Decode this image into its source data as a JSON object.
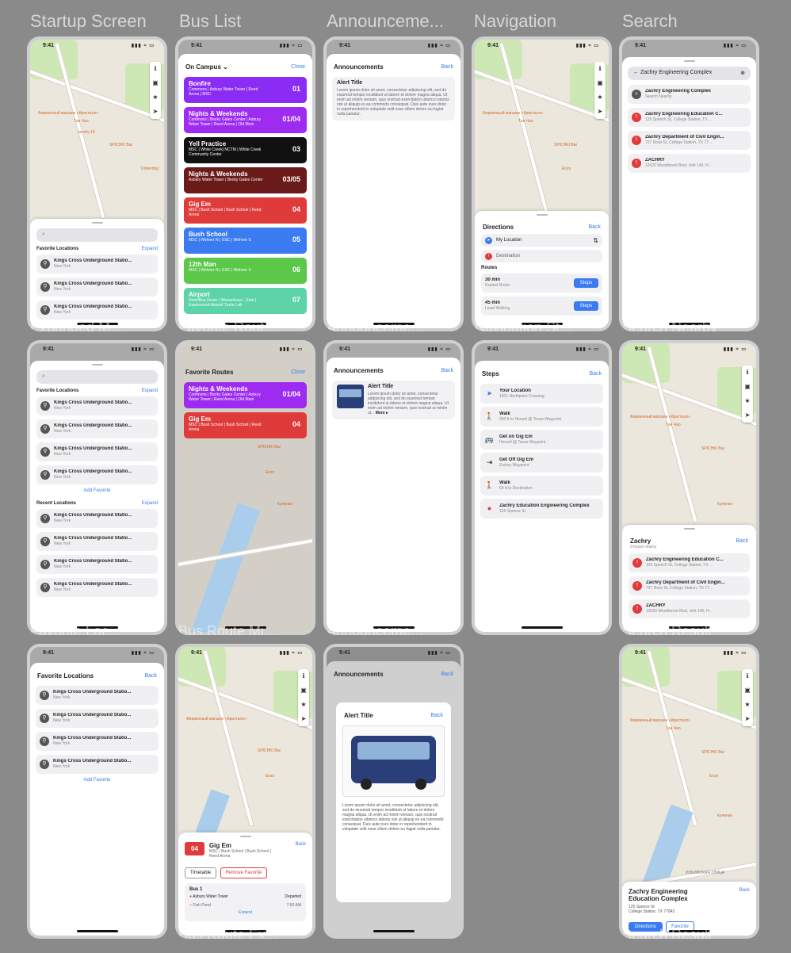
{
  "columns": [
    "Startup Screen",
    "Bus List",
    "Announceme...",
    "Navigation",
    "Search"
  ],
  "status_time": "9:41",
  "status_icons": "▮▮▮ ≈ ▭",
  "map_pois": {
    "poi1": "Фирменный магазин «Кристалл»",
    "poi2": "Тан Чао",
    "poi3": "vershy 19",
    "poi4": "SPICHKI Bar",
    "poi5": "Underdog",
    "poi6": "Enzo",
    "poi7": "Кулинан",
    "street": "ИЛЬИНСКАЯ УЛИЦА"
  },
  "captions": {
    "c1": "Expanded M...",
    "c2": "Favorite Rout...",
    "c3": "Announceme...",
    "c4": "Navigation St...",
    "c5": "Search Nearby",
    "c6": "Favorite Loc...",
    "c7": "Bus Route Mi...",
    "c8": "Announceme...",
    "c9": "Search Result",
    "c10": "Bus Route Ex...",
    "c11": "Search Result"
  },
  "favorites": {
    "label": "Favorite Locations",
    "expand": "Expand",
    "add": "Add Favorite",
    "back": "Back",
    "item_title": "Kings Cross Underground Statio...",
    "item_sub": "New York"
  },
  "recent": {
    "label": "Recent Locations",
    "expand": "Expand"
  },
  "buslist": {
    "title": "On Campus ⌄",
    "close": "Close",
    "fav_title": "Favorite Routes",
    "routes": [
      {
        "name": "Bonfire",
        "stops": "Commons | Asbury Water Tower | Reed Arena | MSC",
        "num": "01",
        "color": "#8b2cf5"
      },
      {
        "name": "Nights & Weekends",
        "stops": "Commons | Becky Gates Center | Asbury Water Tower | Reed Arena | Old Main",
        "num": "01/04",
        "color": "#9d2cf0"
      },
      {
        "name": "Yell Practice",
        "stops": "MSC | White Creek| NCTM | White Creek Community Center",
        "num": "03",
        "color": "#111111"
      },
      {
        "name": "Nights & Weekends",
        "stops": "Asbury Water Tower | Becky Gates Center",
        "num": "03/05",
        "color": "#6b1a1a"
      },
      {
        "name": "Gig Em",
        "stops": "MSC | Bush School | Bush School | Reed Arena",
        "num": "04",
        "color": "#e03b3b"
      },
      {
        "name": "Bush School",
        "stops": "MSC | Wehner N | GSC | Wehner S",
        "num": "05",
        "color": "#3a7bf2"
      },
      {
        "name": "12th Man",
        "stops": "MSC | Wehner N | GSC | Wehner S",
        "num": "06",
        "color": "#5bc84a"
      },
      {
        "name": "Airport",
        "stops": "Hotel/Bus Route | Wiesenhaus - East | Easterwood Airport/ Turtle Lab",
        "num": "07",
        "color": "#5dd3a8"
      }
    ]
  },
  "announce": {
    "title": "Announcements",
    "back": "Back",
    "alert_title": "Alert Title",
    "body": "Lorem ipsum dolor sit amet, consectetur adipiscing elit, sed do eiusmod tempor incididunt ut labore et dolore magna aliqua. Ut enim ad minim veniam, quis nostrud exercitation ullamco laboris nisi ut aliquip ex ea commodo consequat. Duis aute irure dolor in reprehenderit in voluptate velit esse cillum dolore eu fugiat nulla pariatur.",
    "short": "Lorem ipsum dolor sit amet, consectetur adipiscing elit, sed do eiusmod tempor incididunt ut labore et dolore magna aliqua. Ut enim ad minim veniam, quis nostrud ut minim ut...",
    "more": "More ▸"
  },
  "nav": {
    "title": "Directions",
    "back": "Back",
    "my_location": "My Location",
    "destination": "Destination",
    "routes_label": "Routes",
    "r1_time": "30 min",
    "r1_desc": "Fastest Route",
    "r2_time": "45 min",
    "r2_desc": "Least Walking",
    "steps_btn": "Steps"
  },
  "steps": {
    "title": "Steps",
    "back": "Back",
    "items": [
      {
        "t": "Your Location",
        "s": "1501 Northpoint Crossing",
        "i": "➤"
      },
      {
        "t": "Walk",
        "s": "900 ft to Hensel @ Texas Waypoint",
        "i": "🚶"
      },
      {
        "t": "Get on Gig Em",
        "s": "Hensel @ Texas Waypoint",
        "i": "🚌"
      },
      {
        "t": "Get Off Gig Em",
        "s": "Zachry Waypoint",
        "i": "⇥"
      },
      {
        "t": "Walk",
        "s": "50 ft to Destination",
        "i": "🚶"
      },
      {
        "t": "Zachry Education Engineering Complex",
        "s": "125 Spence St",
        "i": "●"
      }
    ]
  },
  "search": {
    "query": "Zachry Engineering Complex",
    "nearby_title": "Zachry Engineering Complex",
    "nearby_sub": "Search Nearby",
    "results": [
      {
        "t": "Zachry Engineering Education C...",
        "s": "125 Spench St, College Station, TX ..."
      },
      {
        "t": "Zachry Department of Civil Engin...",
        "s": "727 Ross St, College Station, TX 77..."
      },
      {
        "t": "ZACHRY",
        "s": "12620 Woodforest Blvd, Unit 140, H..."
      }
    ],
    "result_title": "Zachry",
    "result_sub": "3 found nearby",
    "back": "Back",
    "detail_title": "Zachry Engineering Education Complex",
    "detail_addr1": "125 Spence St",
    "detail_addr2": "College Station, TX 77843",
    "directions": "Directions",
    "favorite": "Favorite"
  },
  "busroute": {
    "num": "04",
    "name": "Gig Em",
    "stops": "MSC | Bush School | Bush School | Reed Arena",
    "back": "Back",
    "timetable": "Timetable",
    "remove": "Remove Favorite",
    "bus": "Bus 1",
    "stop1": "Asbury Water Tower",
    "stop1_status": "Departed",
    "stop2": "Fish Pond",
    "stop2_time": "7:50 AM",
    "expand": "Expand"
  }
}
